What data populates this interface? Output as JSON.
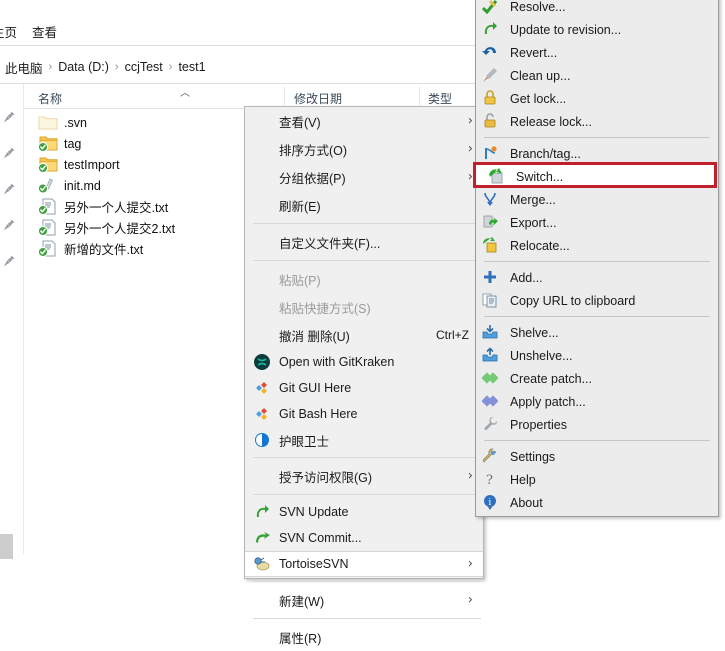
{
  "window": {
    "ribbon_tabs": [
      {
        "label": "主页",
        "name": "tab-home"
      },
      {
        "label": "查看",
        "name": "tab-view"
      }
    ],
    "breadcrumb": [
      "此电脑",
      "Data (D:)",
      "ccjTest",
      "test1"
    ],
    "breadcrumb_separator": "›"
  },
  "columns": {
    "name": "名称",
    "date_modified": "修改日期",
    "type": "类型",
    "sort_indicator": "︿"
  },
  "files": [
    {
      "name": ".svn",
      "icon": "folder-plain-icon"
    },
    {
      "name": "tag",
      "icon": "folder-svn-ok-icon"
    },
    {
      "name": "testImport",
      "icon": "folder-svn-ok-icon"
    },
    {
      "name": "init.md",
      "icon": "file-svn-ok-icon"
    },
    {
      "name": "另外一个人提交.txt",
      "icon": "textfile-svn-ok-icon"
    },
    {
      "name": "另外一个人提交2.txt",
      "icon": "textfile-svn-ok-icon"
    },
    {
      "name": "新增的文件.txt",
      "icon": "textfile-svn-ok-icon"
    }
  ],
  "context_menu": {
    "items": [
      {
        "label": "查看(V)",
        "icon": null,
        "submenu": true,
        "disabled": false,
        "accel": ""
      },
      {
        "label": "排序方式(O)",
        "icon": null,
        "submenu": true,
        "disabled": false,
        "accel": ""
      },
      {
        "label": "分组依据(P)",
        "icon": null,
        "submenu": true,
        "disabled": false,
        "accel": ""
      },
      {
        "label": "刷新(E)",
        "icon": null,
        "submenu": false,
        "disabled": false,
        "accel": ""
      },
      {
        "separator": true
      },
      {
        "label": "自定义文件夹(F)...",
        "icon": null,
        "submenu": false,
        "disabled": false,
        "accel": ""
      },
      {
        "separator": true
      },
      {
        "label": "粘贴(P)",
        "icon": null,
        "submenu": false,
        "disabled": true,
        "accel": ""
      },
      {
        "label": "粘贴快捷方式(S)",
        "icon": null,
        "submenu": false,
        "disabled": true,
        "accel": ""
      },
      {
        "label": "撤消 删除(U)",
        "icon": null,
        "submenu": false,
        "disabled": false,
        "accel": "Ctrl+Z"
      },
      {
        "label": "Open with GitKraken",
        "icon": "gitkraken-icon",
        "submenu": false,
        "disabled": false,
        "accel": ""
      },
      {
        "label": "Git GUI Here",
        "icon": "git-icon",
        "submenu": false,
        "disabled": false,
        "accel": ""
      },
      {
        "label": "Git Bash Here",
        "icon": "git-icon",
        "submenu": false,
        "disabled": false,
        "accel": ""
      },
      {
        "label": "护眼卫士",
        "icon": "eyecare-icon",
        "submenu": false,
        "disabled": false,
        "accel": ""
      },
      {
        "separator": true
      },
      {
        "label": "授予访问权限(G)",
        "icon": null,
        "submenu": true,
        "disabled": false,
        "accel": ""
      },
      {
        "separator": true
      },
      {
        "label": "SVN Update",
        "icon": "svn-update-icon",
        "submenu": false,
        "disabled": false,
        "accel": ""
      },
      {
        "label": "SVN Commit...",
        "icon": "svn-commit-icon",
        "submenu": false,
        "disabled": false,
        "accel": ""
      },
      {
        "label": "TortoiseSVN",
        "icon": "tortoisesvn-icon",
        "submenu": true,
        "disabled": false,
        "accel": "",
        "hovered": true
      },
      {
        "separator": true
      },
      {
        "label": "新建(W)",
        "icon": null,
        "submenu": true,
        "disabled": false,
        "accel": ""
      },
      {
        "separator": true
      },
      {
        "label": "属性(R)",
        "icon": null,
        "submenu": false,
        "disabled": false,
        "accel": ""
      }
    ]
  },
  "submenu": {
    "title": "TortoiseSVN",
    "highlight_color": "#c0202c",
    "items": [
      {
        "label": "Resolve...",
        "icon": "resolve-icon"
      },
      {
        "label": "Update to revision...",
        "icon": "update-revision-icon"
      },
      {
        "label": "Revert...",
        "icon": "revert-icon"
      },
      {
        "label": "Clean up...",
        "icon": "cleanup-icon"
      },
      {
        "label": "Get lock...",
        "icon": "lock-open-icon"
      },
      {
        "label": "Release lock...",
        "icon": "lock-closed-icon"
      },
      {
        "separator": true
      },
      {
        "label": "Branch/tag...",
        "icon": "branch-tag-icon"
      },
      {
        "label": "Switch...",
        "icon": "switch-icon",
        "highlighted": true
      },
      {
        "label": "Merge...",
        "icon": "merge-icon"
      },
      {
        "label": "Export...",
        "icon": "export-icon"
      },
      {
        "label": "Relocate...",
        "icon": "relocate-icon"
      },
      {
        "separator": true
      },
      {
        "label": "Add...",
        "icon": "add-icon"
      },
      {
        "label": "Copy URL to clipboard",
        "icon": "copy-url-icon"
      },
      {
        "separator": true
      },
      {
        "label": "Shelve...",
        "icon": "shelve-icon"
      },
      {
        "label": "Unshelve...",
        "icon": "unshelve-icon"
      },
      {
        "label": "Create patch...",
        "icon": "create-patch-icon"
      },
      {
        "label": "Apply patch...",
        "icon": "apply-patch-icon"
      },
      {
        "label": "Properties",
        "icon": "properties-icon"
      },
      {
        "separator": true
      },
      {
        "label": "Settings",
        "icon": "settings-icon"
      },
      {
        "label": "Help",
        "icon": "help-icon"
      },
      {
        "label": "About",
        "icon": "about-icon"
      }
    ]
  }
}
